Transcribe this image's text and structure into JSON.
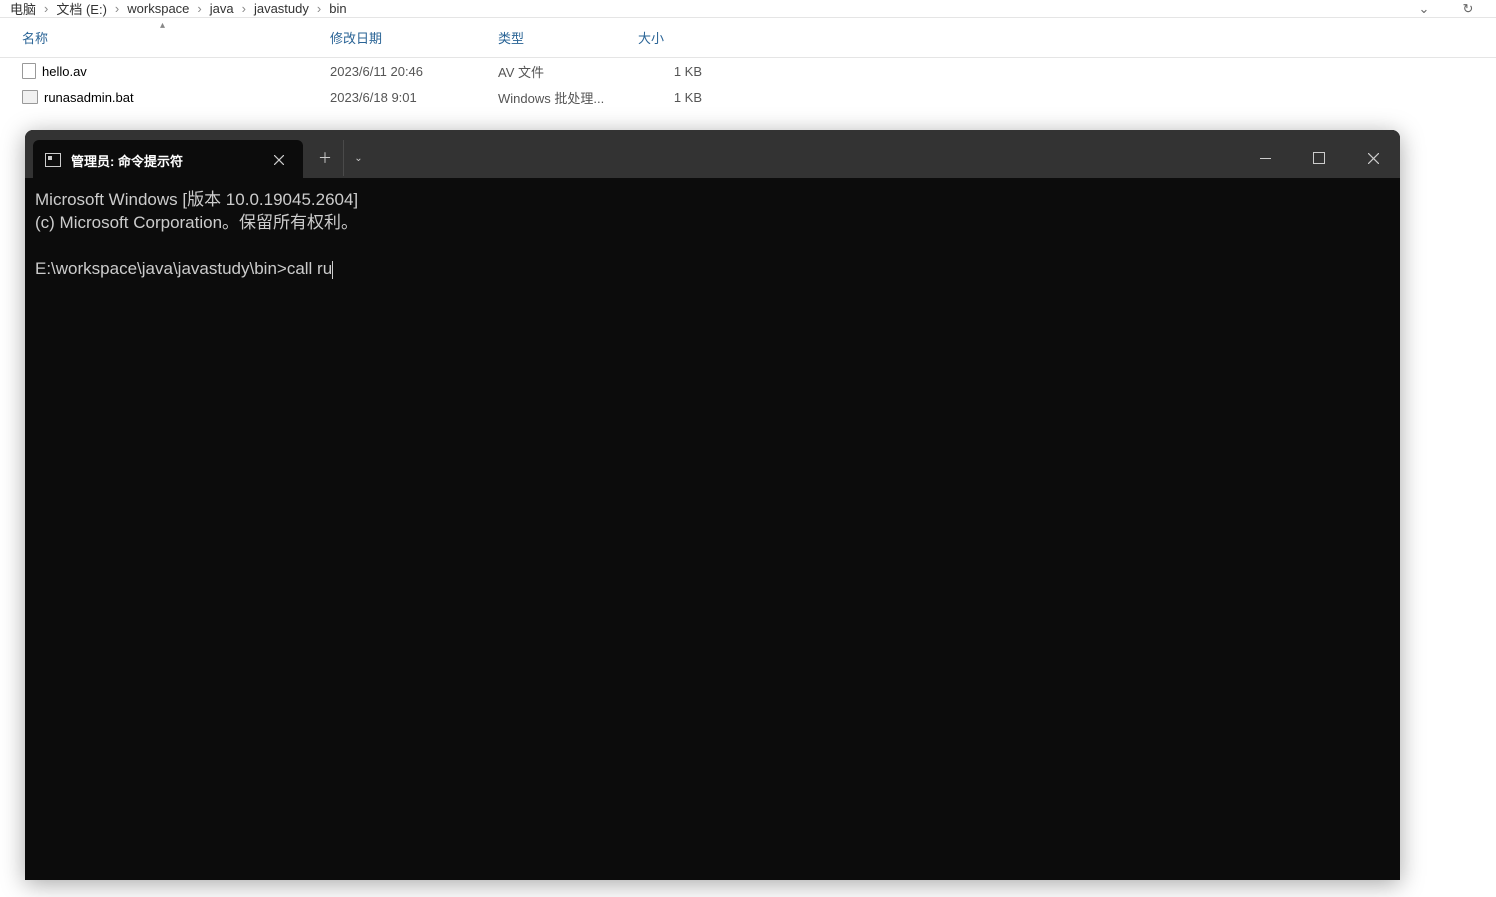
{
  "breadcrumb": {
    "items": [
      "电脑",
      "文档 (E:)",
      "workspace",
      "java",
      "javastudy",
      "bin"
    ]
  },
  "columns": {
    "name": "名称",
    "date": "修改日期",
    "type": "类型",
    "size": "大小"
  },
  "files": [
    {
      "name": "hello.av",
      "date": "2023/6/11 20:46",
      "type": "AV 文件",
      "size": "1 KB",
      "icon": "file-icon-doc"
    },
    {
      "name": "runasadmin.bat",
      "date": "2023/6/18 9:01",
      "type": "Windows 批处理...",
      "size": "1 KB",
      "icon": "file-icon-bat"
    }
  ],
  "terminal": {
    "tab_title": "管理员: 命令提示符",
    "lines": {
      "l1": "Microsoft Windows [版本 10.0.19045.2604]",
      "l2": "(c) Microsoft Corporation。保留所有权利。",
      "prompt": "E:\\workspace\\java\\javastudy\\bin>call ru"
    }
  }
}
